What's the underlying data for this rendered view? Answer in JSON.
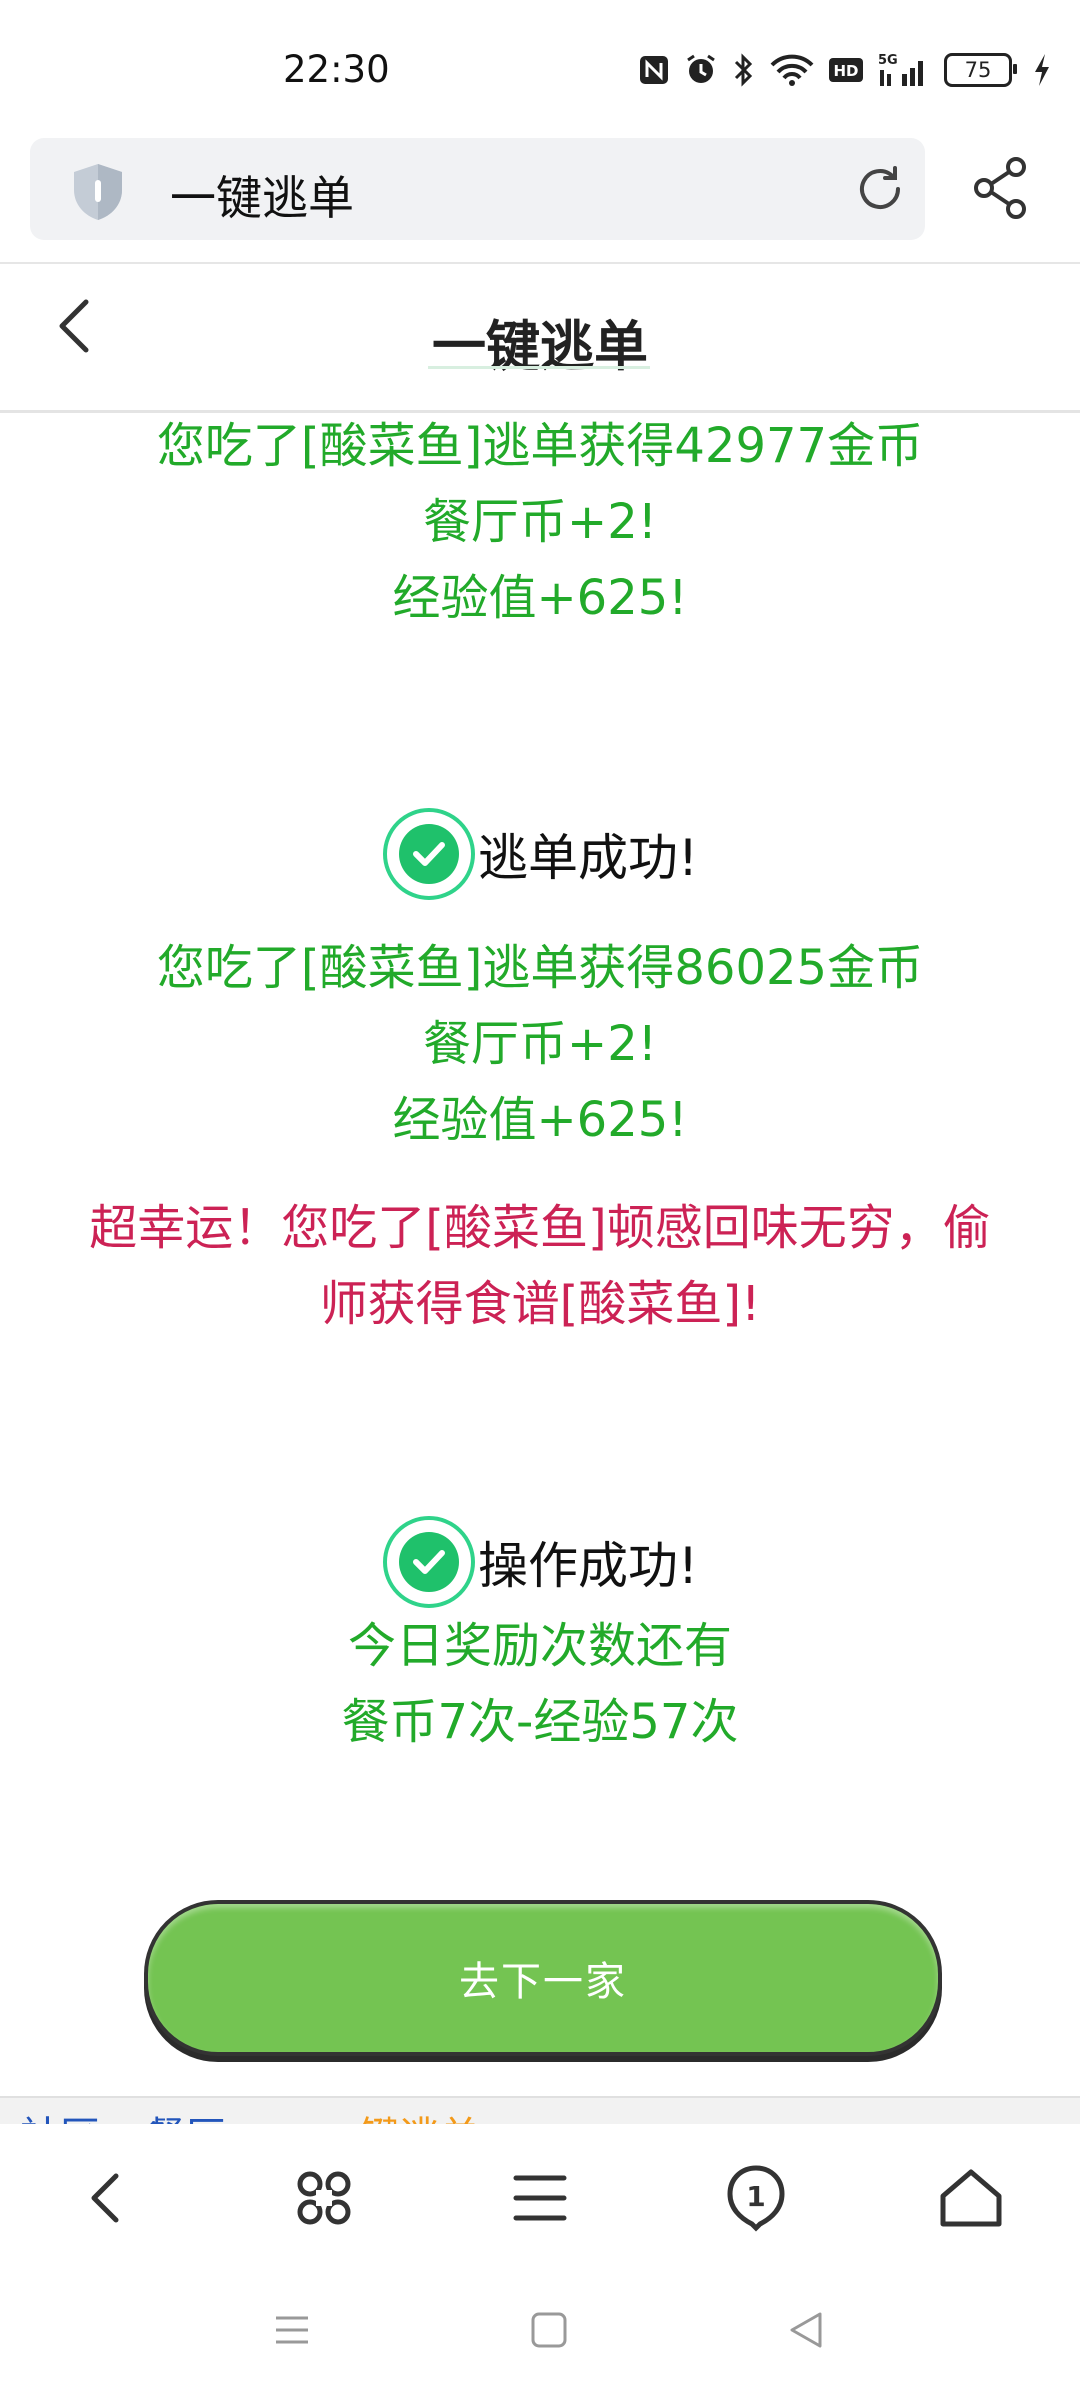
{
  "status_bar": {
    "time": "22:30",
    "battery_level": "75",
    "icons": [
      "nfc-icon",
      "alarm-icon",
      "bluetooth-icon",
      "wifi-icon",
      "hd-icon",
      "5g-signal-icon",
      "battery-icon",
      "charging-icon"
    ]
  },
  "browser": {
    "url_text": "一键逃单",
    "shield_icon": "shield-icon",
    "reload_icon": "reload-icon",
    "share_icon": "share-icon"
  },
  "page": {
    "title": "一键逃单",
    "back_icon": "chevron-left-icon"
  },
  "results": [
    {
      "lines": [
        "您吃了[酸菜鱼]逃单获得42977金币",
        "餐厅币+2!",
        "经验值+625!"
      ]
    },
    {
      "status": "逃单成功!",
      "lines": [
        "您吃了[酸菜鱼]逃单获得86025金币",
        "餐厅币+2!",
        "经验值+625!"
      ],
      "lucky_lines": [
        "超幸运！您吃了[酸菜鱼]顿感回味无穷，偷",
        "师获得食谱[酸菜鱼]!"
      ]
    },
    {
      "status": "操作成功!",
      "lines": [
        "今日奖励次数还有",
        "餐币7次-经验57次"
      ]
    }
  ],
  "next_button_label": "去下一家",
  "breadcrumb": {
    "item1": "社区",
    "item2": "餐厅",
    "item3": "一键逃单"
  },
  "colors": {
    "green_text": "#22aa2a",
    "red_text": "#cc2255",
    "button_green": "#74c452",
    "check_green": "#1fc16b"
  },
  "browser_bar": [
    "back-icon",
    "apps-icon",
    "menu-icon",
    "tabs-icon",
    "home-icon"
  ],
  "browser_tabs_count": "1",
  "system_nav": [
    "recent-apps-icon",
    "home-square-icon",
    "back-triangle-icon"
  ]
}
